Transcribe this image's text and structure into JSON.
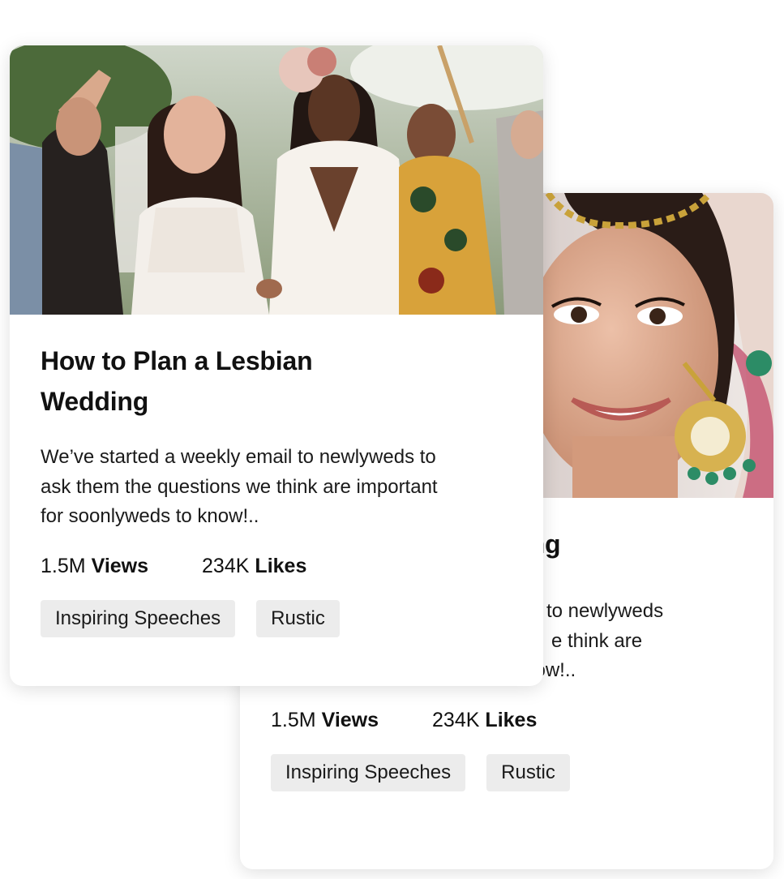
{
  "cards": [
    {
      "title": "How to Plan a Lesbian Wedding",
      "excerpt": "We’ve started a weekly email to newlyweds to ask them the questions we think are important for soonlyweds to know!..",
      "stats": [
        {
          "value": "1.5M",
          "label": "Views"
        },
        {
          "value": "234K",
          "label": "Likes"
        }
      ],
      "tags": [
        "Inspiring Speeches",
        "Rustic"
      ]
    },
    {
      "title": "ing",
      "excerpt_visible": "important for soonlyweds to know!..",
      "excerpt_fragments": [
        "to newlyweds",
        "e think are"
      ],
      "stats": [
        {
          "value": "1.5M",
          "label": "Views"
        },
        {
          "value": "234K",
          "label": "Likes"
        }
      ],
      "tags": [
        "Inspiring Speeches",
        "Rustic"
      ]
    }
  ],
  "colors": {
    "tag_background": "#ececec",
    "text": "#111111",
    "card_background": "#ffffff"
  }
}
